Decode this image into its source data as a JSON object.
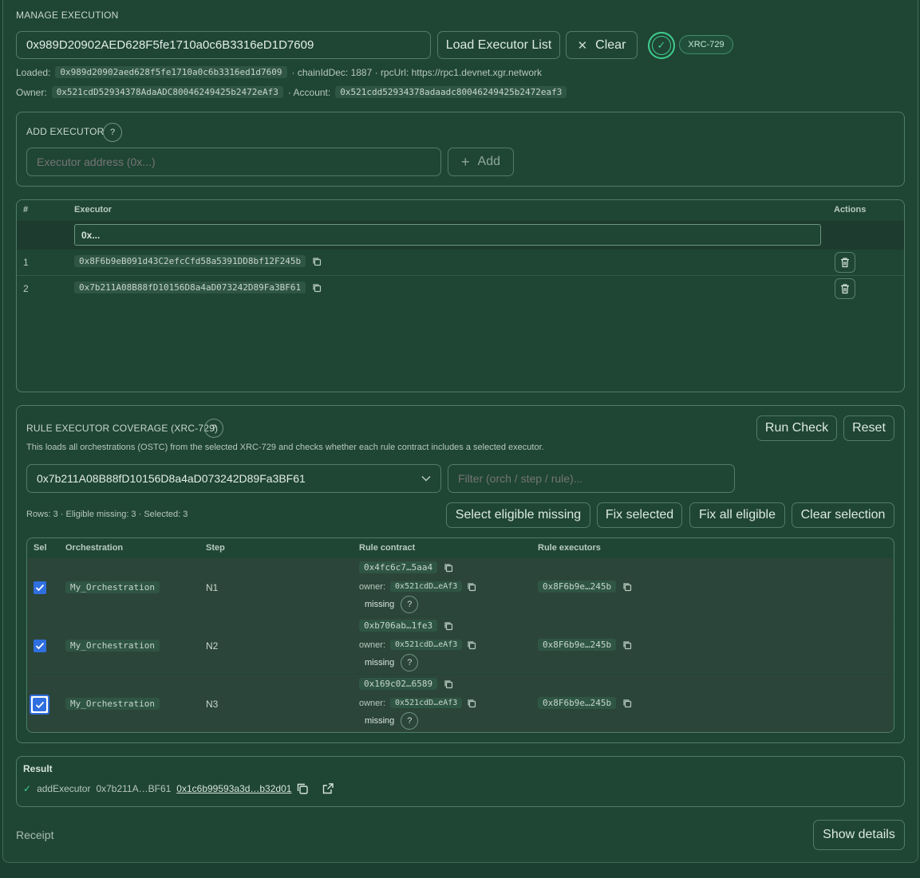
{
  "header": {
    "title": "MANAGE EXECUTION",
    "address_value": "0x989D20902AED628F5fe1710a0c6B3316eD1D7609",
    "load_label": "Load Executor List",
    "clear_label": "Clear",
    "standard_badge": "XRC-729",
    "loaded_label": "Loaded:",
    "loaded_addr": "0x989d20902aed628f5fe1710a0c6b3316ed1d7609",
    "chain_text": "· chainIdDec: 1887 · rpcUrl: https://rpc1.devnet.xgr.network",
    "owner_label": "Owner:",
    "owner_addr": "0x521cdD52934378AdaADC80046249425b2472eAf3",
    "account_label": "· Account:",
    "account_addr": "0x521cdd52934378adaadc80046249425b2472eaf3"
  },
  "add_executor": {
    "title": "ADD EXECUTOR",
    "help": "?",
    "placeholder": "Executor address (0x...)",
    "add_label": "Add"
  },
  "executors_table": {
    "col_index": "#",
    "col_executor": "Executor",
    "col_actions": "Actions",
    "filter_value": "0x...",
    "rows": [
      {
        "index": "1",
        "address": "0x8F6b9eB091d43C2efcCfd58a5391DD8bf12F245b"
      },
      {
        "index": "2",
        "address": "0x7b211A08B88fD10156D8a4aD073242D89Fa3BF61"
      }
    ]
  },
  "coverage": {
    "title": "RULE EXECUTOR COVERAGE (XRC-729)",
    "help": "?",
    "description": "This loads all orchestrations (OSTC) from the selected XRC-729 and checks whether each rule contract includes a selected executor.",
    "run_label": "Run Check",
    "reset_label": "Reset",
    "selected_executor": "0x7b211A08B88fD10156D8a4aD073242D89Fa3BF61",
    "filter_placeholder": "Filter (orch / step / rule)...",
    "stats": "Rows: 3 · Eligible missing: 3 · Selected: 3",
    "select_missing_label": "Select eligible missing",
    "fix_selected_label": "Fix selected",
    "fix_all_label": "Fix all eligible",
    "clear_selection_label": "Clear selection",
    "col_sel": "Sel",
    "col_orch": "Orchestration",
    "col_step": "Step",
    "col_rule": "Rule contract",
    "col_execs": "Rule executors",
    "owner_label": "owner:",
    "missing_label": "missing",
    "rows": [
      {
        "orch": "My_Orchestration",
        "step": "N1",
        "rule": "0x4fc6c7…5aa4",
        "owner": "0x521cdD…eAf3",
        "executors": "0x8F6b9e…245b"
      },
      {
        "orch": "My_Orchestration",
        "step": "N2",
        "rule": "0xb706ab…1fe3",
        "owner": "0x521cdD…eAf3",
        "executors": "0x8F6b9e…245b"
      },
      {
        "orch": "My_Orchestration",
        "step": "N3",
        "rule": "0x169c02…6589",
        "owner": "0x521cdD…eAf3",
        "executors": "0x8F6b9e…245b"
      }
    ]
  },
  "result": {
    "title": "Result",
    "check": "✓",
    "action": "addExecutor",
    "executor": "0x7b211A…BF61",
    "tx_hash": "0x1c6b99593a3d…b32d01"
  },
  "receipt": {
    "label": "Receipt",
    "show_details_label": "Show details"
  },
  "colors": {
    "background": "#1b3f30",
    "accent_green": "#3fcf8e",
    "checkbox_blue": "#2f6fe0"
  }
}
